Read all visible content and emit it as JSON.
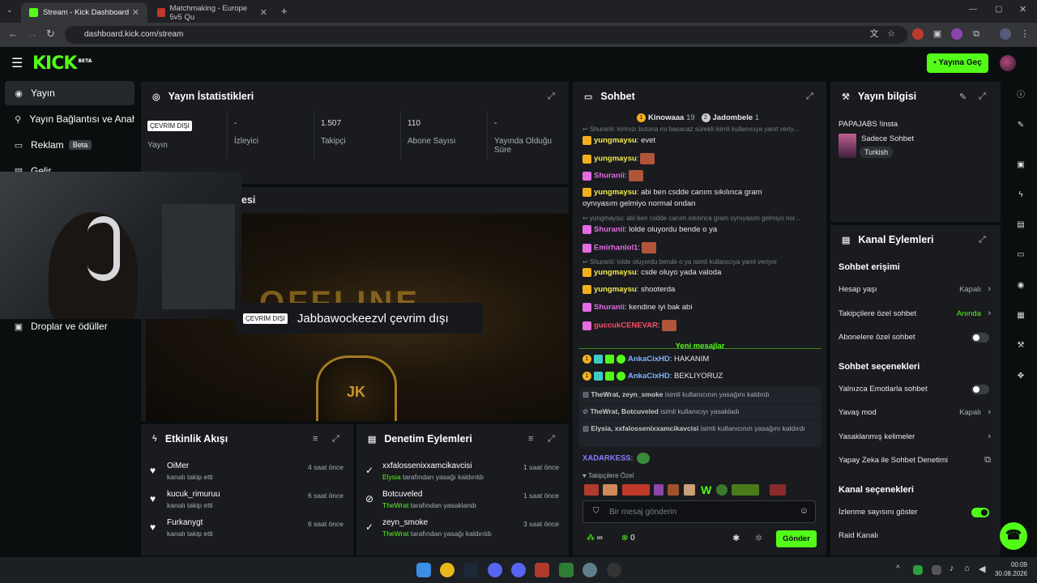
{
  "browser": {
    "tabs": [
      {
        "title": "Stream - Kick Dashboard"
      },
      {
        "title": "Matchmaking - Europe 5v5 Qu"
      }
    ],
    "url": "dashboard.kick.com/stream",
    "new_tab": "+"
  },
  "header": {
    "logo": "KICK",
    "logo_beta": "BETA",
    "go_live": "Yayına Geç"
  },
  "sidebar": {
    "items": [
      {
        "label": "Yayın"
      },
      {
        "label": "Yayın Bağlantısı ve Anahtar"
      },
      {
        "label": "Reklam",
        "badge": "Beta"
      },
      {
        "label": "Gelir"
      },
      {
        "label": "Droplar ve ödüller"
      }
    ]
  },
  "stats": {
    "title": "Yayın İstatistikleri",
    "offline_badge": "ÇEVRİM DIŞI",
    "cells": [
      {
        "value": "",
        "label": "Yayın"
      },
      {
        "value": "-",
        "label": "İzleyici"
      },
      {
        "value": "1.507",
        "label": "Takipçi"
      },
      {
        "value": "110",
        "label": "Abone Sayısı"
      },
      {
        "value": "-",
        "label": "Yayında Olduğu Süre"
      }
    ]
  },
  "preview": {
    "title_fragment": "esi",
    "offline_badge": "ÇEVRİM DIŞI",
    "offline_text": "Jabbawockeezvl çevrim dışı",
    "banner_text": "OFFLINE",
    "emblem_text": "JK"
  },
  "activity": {
    "title": "Etkinlik Akışı",
    "items": [
      {
        "name": "OiMer",
        "sub": "kanalı takip etti",
        "time": "4 saat önce"
      },
      {
        "name": "kucuk_rimuruu",
        "sub": "kanalı takip etti",
        "time": "6 saat önce"
      },
      {
        "name": "Furkanygt",
        "sub": "kanalı takip etti",
        "time": "6 saat önce"
      }
    ]
  },
  "moderation": {
    "title": "Denetim Eylemleri",
    "items": [
      {
        "name": "xxfalossenixxamcikavcisi",
        "actor": "Elysia",
        "sub": " tarafından yasağı kaldırıldı",
        "time": "1 saat önce"
      },
      {
        "name": "Botcuveled",
        "actor": "TheWrat",
        "sub": " tarafından yasaklandı",
        "time": "1 saat önce"
      },
      {
        "name": "zeyn_smoke",
        "actor": "TheWrat",
        "sub": " tarafından yasağı kaldırıldı",
        "time": "3 saat önce"
      }
    ]
  },
  "chat": {
    "title": "Sohbet",
    "top_gifters": [
      {
        "rank": "1",
        "name": "Kinowaaa",
        "count": "19"
      },
      {
        "rank": "2",
        "name": "Jadombele",
        "count": "1"
      }
    ],
    "lines": [
      {
        "kind": "sys",
        "text": "Shuranii: kırmızı butona mı basacaz sürekli isimli kullanıcıya yanıt veriy..."
      },
      {
        "kind": "msg",
        "user": "yungmaysu",
        "color": "#f2e94e",
        "text": " evet"
      },
      {
        "kind": "msg",
        "user": "yungmaysu",
        "color": "#f2e94e",
        "text": ""
      },
      {
        "kind": "msg",
        "user": "Shuranii",
        "color": "#e36ce0",
        "text": ""
      },
      {
        "kind": "msg",
        "user": "yungmaysu",
        "color": "#f2e94e",
        "text": " abi ben csdde canım sıkılınca gram"
      },
      {
        "kind": "cont",
        "text": "oynıyasım gelmiyo normal ondan"
      },
      {
        "kind": "sys",
        "text": "yungmaysu: abi ben csdde canım sıkılınca gram oynıyasım gelmiyo nor..."
      },
      {
        "kind": "msg",
        "user": "Shuranii",
        "color": "#e36ce0",
        "text": " loldе oluyordu bende o ya"
      },
      {
        "kind": "msg",
        "user": "Emirhanlol1",
        "color": "#e36ce0",
        "text": ""
      },
      {
        "kind": "sys",
        "text": "Shuranii: lolde oluyordu bende o ya isimli kullanıcıya yanıt veriyor"
      },
      {
        "kind": "msg",
        "user": "yungmaysu",
        "color": "#f2e94e",
        "text": " csde oluyo yada valoda"
      },
      {
        "kind": "msg",
        "user": "yungmaysu",
        "color": "#f2e94e",
        "text": " shooterda"
      },
      {
        "kind": "msg",
        "user": "Shuranii",
        "color": "#e36ce0",
        "text": " kendine iyi bak abi"
      },
      {
        "kind": "msg",
        "user": "guccukCENEVAR",
        "color": "#ff4d6a",
        "text": ""
      }
    ],
    "new_messages": "Yeni mesajlar",
    "new_lines": [
      {
        "user": "AnkaCixHD",
        "text": " HAKANIM"
      },
      {
        "user": "AnkaCixHD",
        "text": " BEKLIYORUZ"
      }
    ],
    "mod_events": [
      {
        "who": "TheWrat, zeyn_smoke",
        "text": " isimli kullanıcının yasağını kaldırdı"
      },
      {
        "who": "TheWrat, Botcuveled",
        "text": " isimli kullanıcıyı yasakladı"
      },
      {
        "who": "Elysia, xxfalossenixxamcikavcisi",
        "text": " isimli kullanıcının yasağını kaldırdı"
      }
    ],
    "last_user": "XADARKESS",
    "emote_section": "Takipçilere Özel",
    "input_placeholder": "Bir mesaj gönderin",
    "points": "∞",
    "kicks": "0",
    "send": "Gönder"
  },
  "stream_info": {
    "title": "Yayın bilgisi",
    "stream_title": "PAPAJABS !insta",
    "category": "Sadece Sohbet",
    "tag": "Turkish"
  },
  "channel_actions": {
    "title": "Kanal Eylemleri",
    "sections": [
      {
        "heading": "Sohbet erişimi",
        "rows": [
          {
            "label": "Hesap yaşı",
            "value": "Kapalı",
            "type": "chevron"
          },
          {
            "label": "Takipçilere özel sohbet",
            "value": "Anında",
            "type": "chevron",
            "green": true
          },
          {
            "label": "Abonelere özel sohbet",
            "value": "",
            "type": "toggle",
            "on": false
          }
        ]
      },
      {
        "heading": "Sohbet seçenekleri",
        "rows": [
          {
            "label": "Yalnızca Emotlarla sohbet",
            "value": "",
            "type": "toggle",
            "on": false
          },
          {
            "label": "Yavaş mod",
            "value": "Kapalı",
            "type": "chevron"
          },
          {
            "label": "Yasaklanmış kelimeler",
            "value": "",
            "type": "chevron"
          },
          {
            "label": "Yapay Zeka ile Sohbet Denetimi",
            "value": "",
            "type": "external"
          }
        ]
      },
      {
        "heading": "Kanal seçenekleri",
        "rows": [
          {
            "label": "İzlenme sayısını göster",
            "value": "",
            "type": "toggle",
            "on": true
          },
          {
            "label": "Raid Kanalı",
            "value": "",
            "type": "none"
          }
        ]
      }
    ]
  },
  "taskbar": {
    "time": "00:09",
    "date": "30.08.2026"
  },
  "colors": {
    "accent": "#53fc18",
    "panel": "#191b1f",
    "background": "#0b0e0f"
  }
}
